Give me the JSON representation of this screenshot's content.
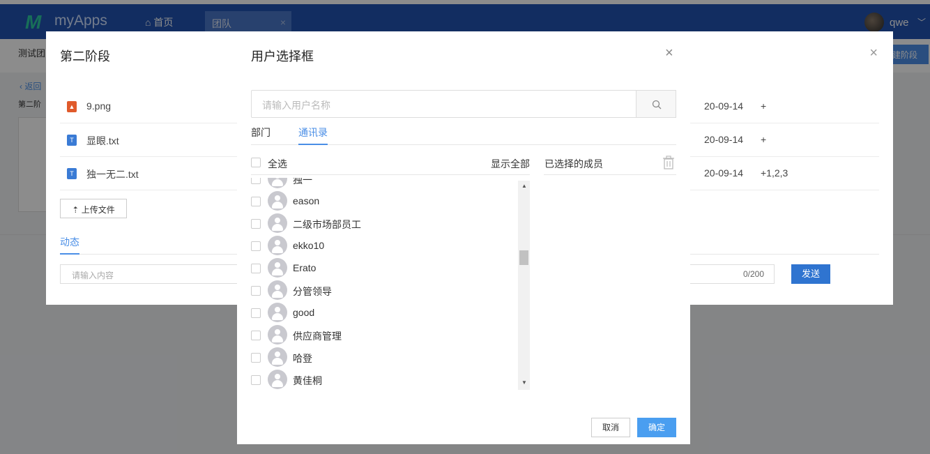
{
  "app": {
    "logo_text": "myApps",
    "nav_home": "首页",
    "nav_tab": "团队",
    "user_name": "qwe"
  },
  "background_page": {
    "subtitle": "测试团",
    "new_stage_btn": "建阶段",
    "back_link": "返回",
    "stage_label": "第二阶"
  },
  "stage_modal": {
    "title": "第二阶段",
    "files": [
      {
        "name": "9.png",
        "type": "image",
        "date": "20-09-14",
        "extra": "+"
      },
      {
        "name": "显眼.txt",
        "type": "text",
        "date": "20-09-14",
        "extra": "+"
      },
      {
        "name": "独一无二.txt",
        "type": "text",
        "date": "20-09-14",
        "extra": "+1,2,3"
      }
    ],
    "upload_label": "上传文件",
    "activity_tab": "动态",
    "comment_placeholder": "请输入内容",
    "counter": "0/200",
    "send_label": "发送"
  },
  "user_dialog": {
    "title": "用户选择框",
    "search_placeholder": "请输入用户名称",
    "tabs": [
      "部门",
      "通讯录"
    ],
    "active_tab": "通讯录",
    "select_all_label": "全选",
    "show_all_label": "显示全部",
    "selected_members_label": "已选择的成员",
    "users": [
      "独一",
      "eason",
      "二级市场部员工",
      "ekko10",
      "Erato",
      "分管领导",
      "good",
      "供应商管理",
      "哈登",
      "黄佳桐"
    ],
    "cancel_label": "取消",
    "confirm_label": "确定"
  },
  "colors": {
    "nav_bg": "#2253b1",
    "accent": "#4a8ee6",
    "primary_button": "#4a9ef0",
    "send_button": "#2f74d0"
  }
}
